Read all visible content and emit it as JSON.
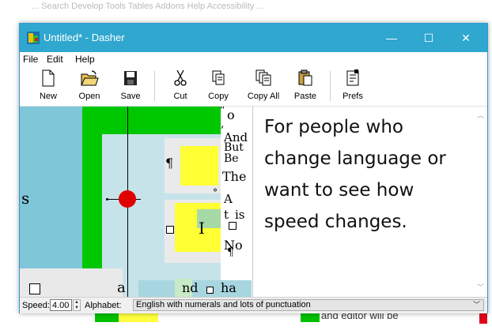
{
  "background": {
    "top_text": "... Search  Develop  Tools  Tables  Addons  Help  Accessibility  ...",
    "bottom_text": "and editor will be"
  },
  "window": {
    "title": "Untitled* - Dasher",
    "controls": {
      "minimize": "—",
      "maximize": "☐",
      "close": "✕"
    }
  },
  "menu": {
    "items": [
      "File",
      "Edit",
      "Help"
    ]
  },
  "toolbar": {
    "new": "New",
    "open": "Open",
    "save": "Save",
    "cut": "Cut",
    "copy": "Copy",
    "copy_all": "Copy All",
    "paste": "Paste",
    "prefs": "Prefs"
  },
  "canvas": {
    "glyphs": [
      "¶",
      "s",
      "I",
      "a",
      "nd",
      "ha",
      "o",
      "And",
      "But",
      "Be",
      "The",
      "A",
      "t",
      "is",
      "No",
      "\"",
      "°",
      "¶",
      ","
    ]
  },
  "editor": {
    "text": "For people who change language or want to see how speed changes."
  },
  "status": {
    "speed_label": "Speed:",
    "speed_value": "4.00",
    "alphabet_label": "Alphabet:",
    "alphabet_value": "English with numerals and lots of punctuation"
  },
  "colors": {
    "titlebar": "#2fa7cf",
    "canvas_bg": "#7fc6d8",
    "green": "#00c800",
    "yellow": "#ffff33",
    "red_pointer": "#e00000"
  }
}
